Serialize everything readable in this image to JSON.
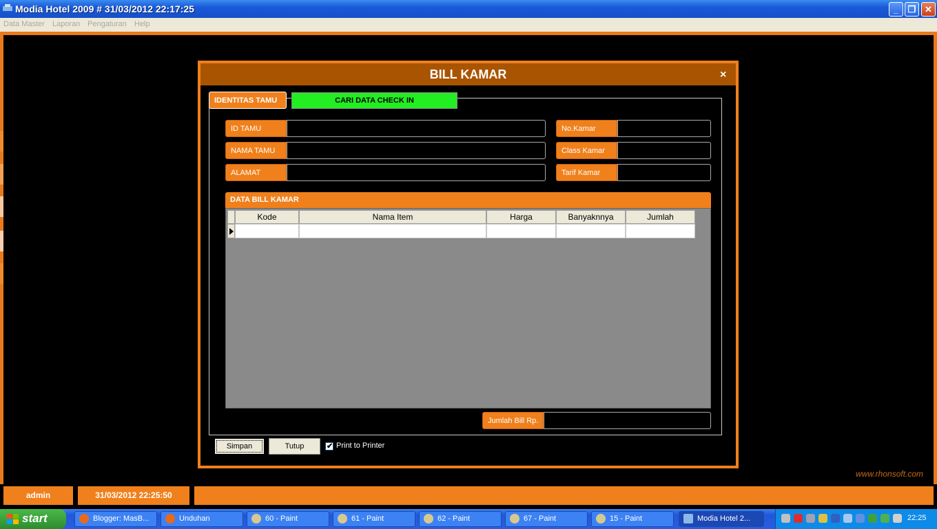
{
  "window": {
    "title": "Modia Hotel 2009 # 31/03/2012 22:17:25",
    "min_glyph": "_",
    "max_glyph": "❐",
    "close_glyph": "✕"
  },
  "menu": {
    "items": [
      "Data Master",
      "Laporan",
      "Pengaturan",
      "Help"
    ]
  },
  "dialog": {
    "title": "BILL KAMAR",
    "close_glyph": "×",
    "tab_identitas": "IDENTITAS TAMU",
    "search_button": "CARI DATA CHECK IN",
    "fields": {
      "id_tamu": {
        "label": "ID TAMU",
        "value": ""
      },
      "nama_tamu": {
        "label": "NAMA TAMU",
        "value": ""
      },
      "alamat": {
        "label": "ALAMAT",
        "value": ""
      },
      "no_kamar": {
        "label": "No.Kamar",
        "value": ""
      },
      "class_kamar": {
        "label": "Class Kamar",
        "value": ""
      },
      "tarif_kamar": {
        "label": "Tarif Kamar",
        "value": ""
      }
    },
    "grid": {
      "title": "DATA BILL KAMAR",
      "columns": [
        "Kode",
        "Nama Item",
        "Harga",
        "Banyaknnya",
        "Jumlah"
      ],
      "rows": []
    },
    "total": {
      "label": "Jumlah Bill Rp.",
      "value": ""
    },
    "save_button": "Simpan",
    "close_button": "Tutup",
    "print_checkbox": {
      "label": "Print to Printer",
      "checked": true,
      "glyph": "✔"
    }
  },
  "brand": "www.rhonsoft.com",
  "status": {
    "user": "admin",
    "datetime": "31/03/2012 22:25:50",
    "message": ""
  },
  "taskbar": {
    "start_label": "start",
    "tasks": [
      "Blogger: MasB...",
      "Unduhan",
      "60 - Paint",
      "61 - Paint",
      "62 - Paint",
      "67 - Paint",
      "15 - Paint",
      "Modia Hotel 2..."
    ],
    "clock": "22:25"
  },
  "colors": {
    "accent_orange": "#f0801c",
    "header_brown": "#a95400",
    "search_green": "#22ee22",
    "taskbar_blue": "#2058d8"
  }
}
